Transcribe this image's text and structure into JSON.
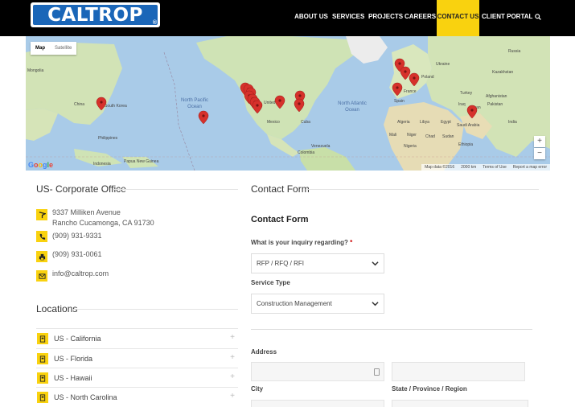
{
  "brand": {
    "logo_text": "CALTROP",
    "logo_reg": "®"
  },
  "nav": {
    "items": [
      "ABOUT US",
      "SERVICES",
      "PROJECTS",
      "CAREERS",
      "CONTACT US",
      "CLIENT PORTAL"
    ],
    "active": "CONTACT US"
  },
  "map": {
    "toggle_map": "Map",
    "toggle_satellite": "Satellite",
    "zoom_in": "+",
    "zoom_out": "−",
    "google": "Google",
    "footer": [
      "Map data ©2016",
      "2000 km",
      "Terms of Use",
      "Report a map error"
    ],
    "labels": {
      "north_pacific": "North Pacific Ocean",
      "north_atlantic": "North Atlantic Ocean",
      "china": "China",
      "south_korea": "South Korea",
      "philippines": "Philippines",
      "indonesia": "Indonesia",
      "papua": "Papua New Guinea",
      "united": "United",
      "mexico": "Mexico",
      "cuba": "Cuba",
      "venezuela": "Venezuela",
      "colombia": "Colombia",
      "france": "France",
      "spain": "Spain",
      "poland": "Poland",
      "algeria": "Algeria",
      "libya": "Libya",
      "egypt": "Egypt",
      "mali": "Mali",
      "niger": "Niger",
      "chad": "Chad",
      "sudan": "Sudan",
      "nigeria": "Nigeria",
      "ethiopia": "Ethiopia",
      "saudi": "Saudi Arabia",
      "iraq": "Iraq",
      "iran": "Iran",
      "afghanistan": "Afghanistan",
      "pakistan": "Pakistan",
      "turkey": "Turkey",
      "kazakhstan": "Kazakhstan",
      "mongolia": "Mongolia",
      "russia": "Russia",
      "ukraine": "Ukraine",
      "india": "India"
    }
  },
  "corporate": {
    "title": "US- Corporate Office",
    "address_line1": "9337 Milliken Avenue",
    "address_line2": "Rancho Cucamonga, CA 91730",
    "phone": "(909) 931-9331",
    "fax": "(909) 931-0061",
    "email": "info@caltrop.com"
  },
  "locations": {
    "title": "Locations",
    "items": [
      "US - California",
      "US - Florida",
      "US - Hawaii",
      "US - North Carolina"
    ],
    "expand_symbol": "+"
  },
  "contact_form": {
    "section_title": "Contact Form",
    "form_title": "Contact Form",
    "inquiry_label": "What is your inquiry regarding?",
    "required_mark": "*",
    "inquiry_value": "RFP / RFQ / RFI",
    "service_label": "Service Type",
    "service_value": "Construction Management",
    "address_label": "Address",
    "city_label": "City",
    "state_label": "State / Province / Region"
  },
  "colors": {
    "accent": "#f9d20f",
    "header_bg": "#000000",
    "logo_blue": "#1a66b8",
    "pin": "#d6312b"
  }
}
